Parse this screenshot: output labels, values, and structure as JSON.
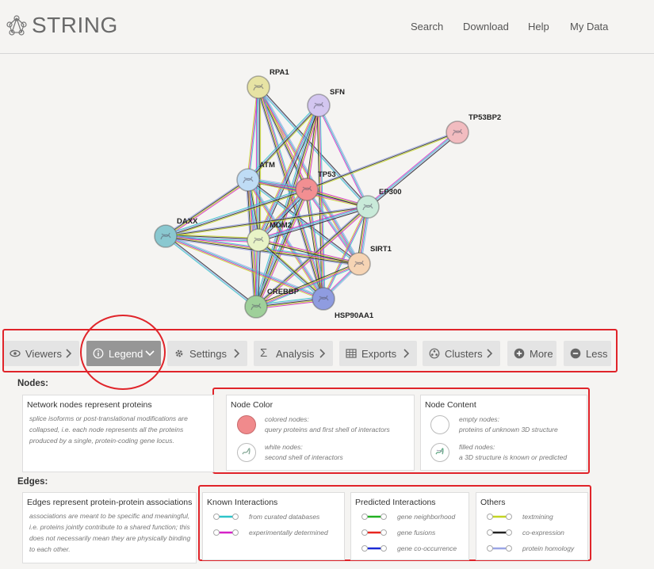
{
  "header": {
    "logo_text": "STRING",
    "nav": [
      "Search",
      "Download",
      "Help",
      "My Data"
    ]
  },
  "network": {
    "nodes": [
      {
        "id": "RPA1",
        "color": "#e7e3a4"
      },
      {
        "id": "SFN",
        "color": "#d3c6f0"
      },
      {
        "id": "TP53BP2",
        "color": "#f2bcc0"
      },
      {
        "id": "ATM",
        "color": "#bfdcf5"
      },
      {
        "id": "TP53",
        "color": "#f28f92"
      },
      {
        "id": "EP300",
        "color": "#c9ead9"
      },
      {
        "id": "DAXX",
        "color": "#8ac8d0"
      },
      {
        "id": "MDM2",
        "color": "#e8f3c6"
      },
      {
        "id": "SIRT1",
        "color": "#f6d4b4"
      },
      {
        "id": "HSP90AA1",
        "color": "#8f9ce0"
      },
      {
        "id": "CREBBP",
        "color": "#9fd09a"
      }
    ]
  },
  "toolbar": {
    "buttons": [
      {
        "label": "Viewers",
        "icon": "eye-icon"
      },
      {
        "label": "Legend",
        "icon": "info-icon"
      },
      {
        "label": "Settings",
        "icon": "gear-icon"
      },
      {
        "label": "Analysis",
        "icon": "sigma-icon"
      },
      {
        "label": "Exports",
        "icon": "table-icon"
      },
      {
        "label": "Clusters",
        "icon": "cluster-icon"
      },
      {
        "label": "More",
        "icon": "plus-circle-icon"
      },
      {
        "label": "Less",
        "icon": "minus-circle-icon"
      }
    ],
    "active": "Legend"
  },
  "legend": {
    "nodes_title": "Nodes:",
    "edges_title": "Edges:",
    "nodes_box": {
      "title": "Network nodes represent proteins",
      "text": "splice isoforms or post-translational modifications are collapsed, i.e. each node represents all the proteins produced by a single, protein-coding gene locus."
    },
    "node_color": {
      "title": "Node Color",
      "colored_line1": "colored nodes:",
      "colored_line2": "query proteins and first shell of interactors",
      "white_line1": "white nodes:",
      "white_line2": "second shell of interactors"
    },
    "node_content": {
      "title": "Node Content",
      "empty_line1": "empty nodes:",
      "empty_line2": "proteins of unknown 3D structure",
      "filled_line1": "filled nodes:",
      "filled_line2": "a 3D structure is known or predicted"
    },
    "edges_box": {
      "title": "Edges represent protein-protein associations",
      "text": "associations are meant to be specific and meaningful, i.e. proteins jointly contribute to a shared function; this does not necessarily mean they are physically binding to each other."
    },
    "known": {
      "title": "Known Interactions",
      "items": [
        {
          "label": "from curated databases",
          "color": "#2ec4c9"
        },
        {
          "label": "experimentally determined",
          "color": "#d622c7"
        }
      ]
    },
    "predicted": {
      "title": "Predicted Interactions",
      "items": [
        {
          "label": "gene neighborhood",
          "color": "#22b022"
        },
        {
          "label": "gene fusions",
          "color": "#e8261f"
        },
        {
          "label": "gene co-occurrence",
          "color": "#1d2bd6"
        }
      ]
    },
    "others": {
      "title": "Others",
      "items": [
        {
          "label": "textmining",
          "color": "#c3d422"
        },
        {
          "label": "co-expression",
          "color": "#222222"
        },
        {
          "label": "protein homology",
          "color": "#9aa5e6"
        }
      ]
    }
  }
}
